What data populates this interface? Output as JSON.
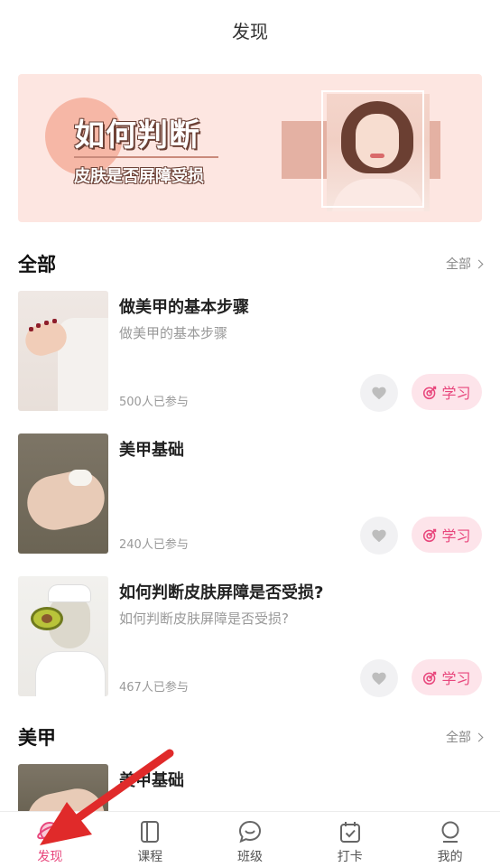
{
  "header": {
    "title": "发现"
  },
  "banner": {
    "headline": "如何判断",
    "subline": "皮肤是否屏障受损"
  },
  "sections": [
    {
      "title": "全部",
      "more_label": "全部"
    },
    {
      "title": "美甲",
      "more_label": "全部"
    }
  ],
  "courses": [
    {
      "title": "做美甲的基本步骤",
      "subtitle": "做美甲的基本步骤",
      "count": "500人已参与",
      "study_label": "学习"
    },
    {
      "title": "美甲基础",
      "subtitle": "",
      "count": "240人已参与",
      "study_label": "学习"
    },
    {
      "title": "如何判断皮肤屏障是否受损?",
      "subtitle": "如何判断皮肤屏障是否受损?",
      "count": "467人已参与",
      "study_label": "学习"
    }
  ],
  "nail_section_courses": [
    {
      "title": "美甲基础"
    }
  ],
  "tabbar": {
    "items": [
      {
        "label": "发现",
        "icon": "planet-icon",
        "active": true
      },
      {
        "label": "课程",
        "icon": "book-icon",
        "active": false
      },
      {
        "label": "班级",
        "icon": "chat-bubble-icon",
        "active": false
      },
      {
        "label": "打卡",
        "icon": "calendar-check-icon",
        "active": false
      },
      {
        "label": "我的",
        "icon": "user-icon",
        "active": false
      }
    ]
  },
  "colors": {
    "accent": "#e8467c",
    "banner_bg": "#fde6e1",
    "study_bg": "#fde4ea",
    "arrow": "#e02a2a"
  }
}
